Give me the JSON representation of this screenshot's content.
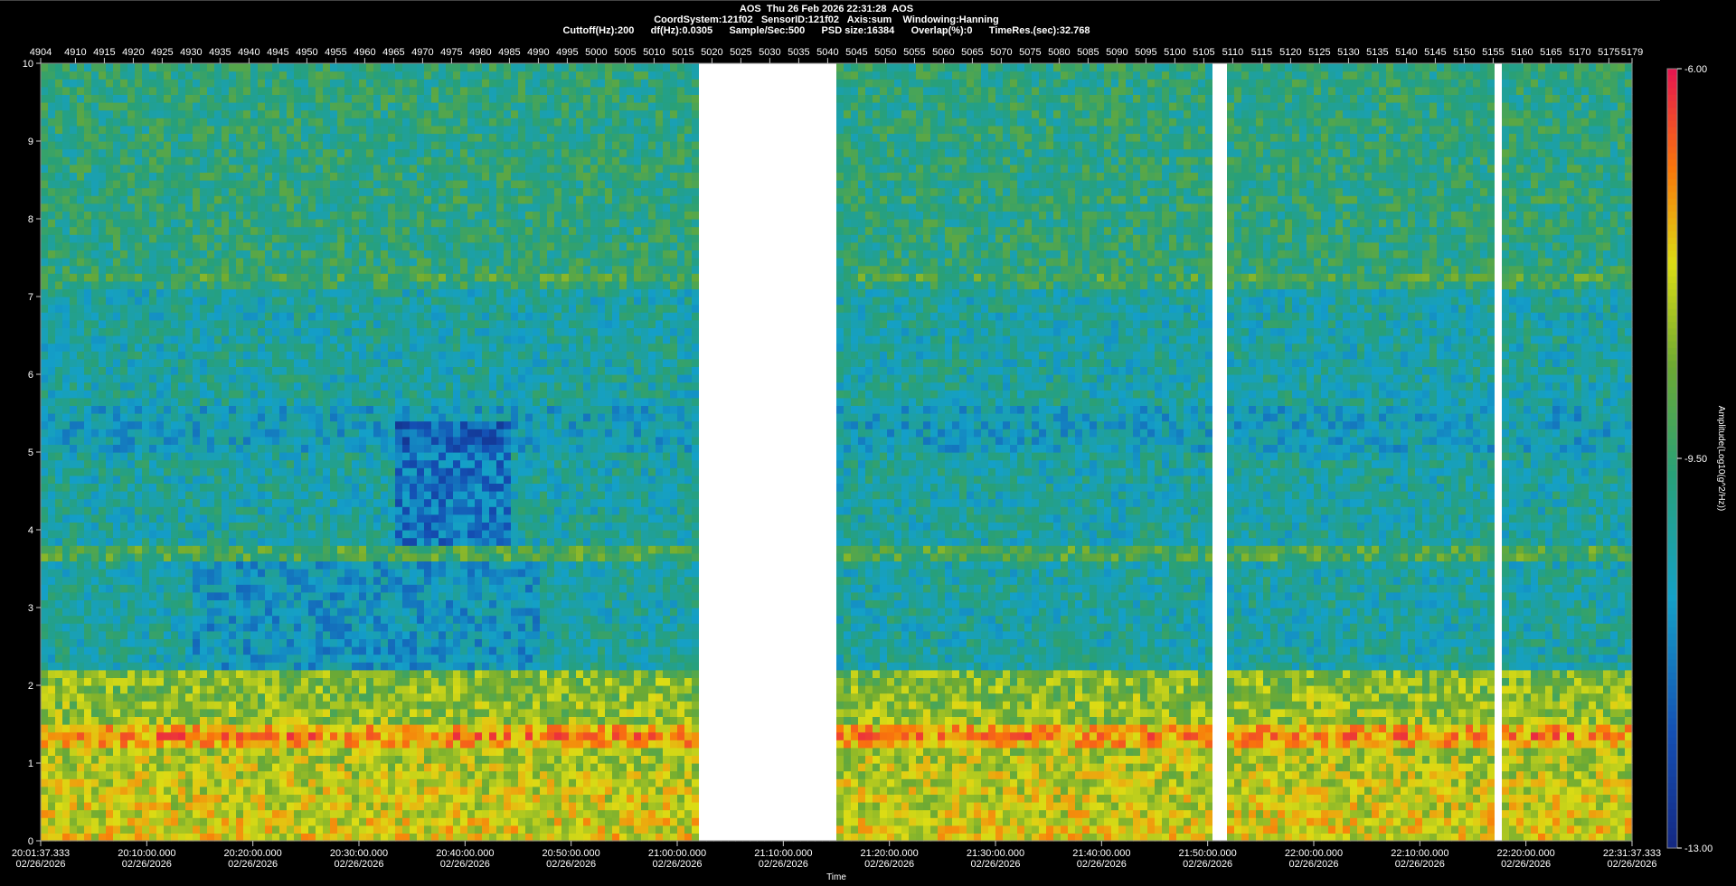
{
  "header": {
    "line1": "AOS  Thu 26 Feb 2026 22:31:28  AOS",
    "line2": "CoordSystem:121f02   SensorID:121f02   Axis:sum    Windowing:Hanning",
    "line3": "Cuttoff(Hz):200      df(Hz):0.0305      Sample/Sec:500      PSD size:16384      Overlap(%):0      TimeRes.(sec):32.768"
  },
  "colors": {
    "background": "#000000",
    "gap": "#ffffff",
    "text": "#ffffff"
  },
  "chart_data": {
    "type": "heatmap",
    "title": "AOS  Thu 26 Feb 2026 22:31:28  AOS",
    "xlabel": "Time",
    "ylabel": "",
    "colorbar_label": "Amplitude(Log10(g^2/Hz))",
    "colormap": "jet",
    "ylim": [
      0,
      10
    ],
    "y_ticks": [
      "0",
      "1",
      "2",
      "3",
      "4",
      "5",
      "6",
      "7",
      "8",
      "9",
      "10"
    ],
    "color_range": [
      -13.0,
      -6.0
    ],
    "colorbar_ticks": [
      "-6.00",
      "-9.50",
      "-13.00"
    ],
    "top_axis_ticks": [
      "4904",
      "4910",
      "4915",
      "4920",
      "4925",
      "4930",
      "4935",
      "4940",
      "4945",
      "4950",
      "4955",
      "4960",
      "4965",
      "4970",
      "4975",
      "4980",
      "4985",
      "4990",
      "4995",
      "5000",
      "5005",
      "5010",
      "5015",
      "5020",
      "5025",
      "5030",
      "5035",
      "5040",
      "5045",
      "5050",
      "5055",
      "5060",
      "5065",
      "5070",
      "5075",
      "5080",
      "5085",
      "5090",
      "5095",
      "5100",
      "5105",
      "5110",
      "5115",
      "5120",
      "5125",
      "5130",
      "5135",
      "5140",
      "5145",
      "5150",
      "5155",
      "5160",
      "5165",
      "5170",
      "5175",
      "5179"
    ],
    "top_axis_range": [
      4904,
      5179
    ],
    "time_ticks": [
      {
        "time": "20:01:37.333",
        "date": "02/26/2026"
      },
      {
        "time": "20:10:00.000",
        "date": "02/26/2026"
      },
      {
        "time": "20:20:00.000",
        "date": "02/26/2026"
      },
      {
        "time": "20:30:00.000",
        "date": "02/26/2026"
      },
      {
        "time": "20:40:00.000",
        "date": "02/26/2026"
      },
      {
        "time": "20:50:00.000",
        "date": "02/26/2026"
      },
      {
        "time": "21:00:00.000",
        "date": "02/26/2026"
      },
      {
        "time": "21:10:00.000",
        "date": "02/26/2026"
      },
      {
        "time": "21:20:00.000",
        "date": "02/26/2026"
      },
      {
        "time": "21:30:00.000",
        "date": "02/26/2026"
      },
      {
        "time": "21:40:00.000",
        "date": "02/26/2026"
      },
      {
        "time": "21:50:00.000",
        "date": "02/26/2026"
      },
      {
        "time": "22:00:00.000",
        "date": "02/26/2026"
      },
      {
        "time": "22:10:00.000",
        "date": "02/26/2026"
      },
      {
        "time": "22:20:00.000",
        "date": "02/26/2026"
      },
      {
        "time": "22:31:37.333",
        "date": "02/26/2026"
      }
    ],
    "data_gaps": [
      [
        5018,
        5041
      ],
      [
        5107,
        5109
      ],
      [
        5155,
        5156
      ]
    ],
    "bands": [
      {
        "freq": 3.7,
        "level": -9.0
      },
      {
        "freq": 1.35,
        "level": -7.0
      },
      {
        "freq": 7.25,
        "level": -9.2
      },
      {
        "freq": 8.25,
        "level": -9.6
      }
    ]
  }
}
